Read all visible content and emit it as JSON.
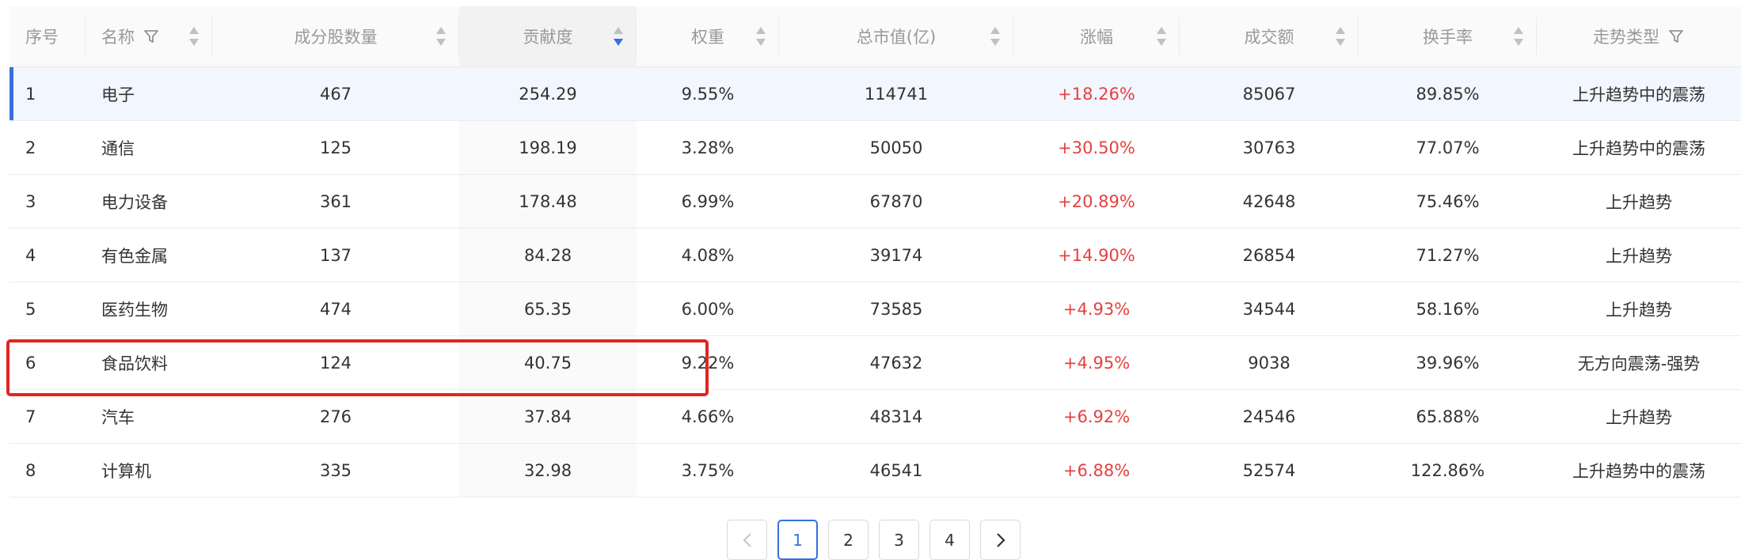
{
  "columns": [
    {
      "label": "序号",
      "sortable": false,
      "filter": false
    },
    {
      "label": "名称",
      "sortable": true,
      "filter": true
    },
    {
      "label": "成分股数量",
      "sortable": true,
      "filter": false
    },
    {
      "label": "贡献度",
      "sortable": true,
      "filter": false,
      "sorted": "desc"
    },
    {
      "label": "权重",
      "sortable": true,
      "filter": false
    },
    {
      "label": "总市值(亿)",
      "sortable": true,
      "filter": false
    },
    {
      "label": "涨幅",
      "sortable": true,
      "filter": false
    },
    {
      "label": "成交额",
      "sortable": true,
      "filter": false
    },
    {
      "label": "换手率",
      "sortable": true,
      "filter": false
    },
    {
      "label": "走势类型",
      "sortable": false,
      "filter": true
    }
  ],
  "rows": [
    {
      "idx": "1",
      "name": "电子",
      "count": "467",
      "contrib": "254.29",
      "weight": "9.55%",
      "mcap": "114741",
      "change": "+18.26%",
      "turnover_amt": "85067",
      "turnover_rate": "89.85%",
      "trend": "上升趋势中的震荡"
    },
    {
      "idx": "2",
      "name": "通信",
      "count": "125",
      "contrib": "198.19",
      "weight": "3.28%",
      "mcap": "50050",
      "change": "+30.50%",
      "turnover_amt": "30763",
      "turnover_rate": "77.07%",
      "trend": "上升趋势中的震荡"
    },
    {
      "idx": "3",
      "name": "电力设备",
      "count": "361",
      "contrib": "178.48",
      "weight": "6.99%",
      "mcap": "67870",
      "change": "+20.89%",
      "turnover_amt": "42648",
      "turnover_rate": "75.46%",
      "trend": "上升趋势"
    },
    {
      "idx": "4",
      "name": "有色金属",
      "count": "137",
      "contrib": "84.28",
      "weight": "4.08%",
      "mcap": "39174",
      "change": "+14.90%",
      "turnover_amt": "26854",
      "turnover_rate": "71.27%",
      "trend": "上升趋势"
    },
    {
      "idx": "5",
      "name": "医药生物",
      "count": "474",
      "contrib": "65.35",
      "weight": "6.00%",
      "mcap": "73585",
      "change": "+4.93%",
      "turnover_amt": "34544",
      "turnover_rate": "58.16%",
      "trend": "上升趋势"
    },
    {
      "idx": "6",
      "name": "食品饮料",
      "count": "124",
      "contrib": "40.75",
      "weight": "9.22%",
      "mcap": "47632",
      "change": "+4.95%",
      "turnover_amt": "9038",
      "turnover_rate": "39.96%",
      "trend": "无方向震荡-强势"
    },
    {
      "idx": "7",
      "name": "汽车",
      "count": "276",
      "contrib": "37.84",
      "weight": "4.66%",
      "mcap": "48314",
      "change": "+6.92%",
      "turnover_amt": "24546",
      "turnover_rate": "65.88%",
      "trend": "上升趋势"
    },
    {
      "idx": "8",
      "name": "计算机",
      "count": "335",
      "contrib": "32.98",
      "weight": "3.75%",
      "mcap": "46541",
      "change": "+6.88%",
      "turnover_amt": "52574",
      "turnover_rate": "122.86%",
      "trend": "上升趋势中的震荡"
    }
  ],
  "pagination": {
    "prev_icon": "chevron-left-icon",
    "pages": [
      "1",
      "2",
      "3",
      "4"
    ],
    "current": "1",
    "next_icon": "chevron-right-icon"
  },
  "colors": {
    "accent": "#3a6ee0",
    "up": "#e64040",
    "highlight_box": "#e0261f"
  }
}
